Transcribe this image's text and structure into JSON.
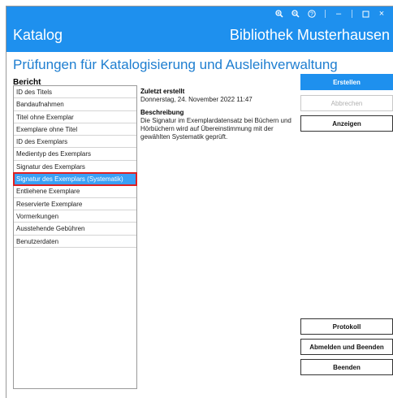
{
  "window": {
    "icons": [
      "zoom-in-icon",
      "zoom-out-icon",
      "help-icon",
      "minimize-icon",
      "maximize-icon",
      "close-icon"
    ],
    "glyphs": {
      "zoom_in": "🔍",
      "zoom_out": "🔍",
      "help": "?",
      "minimize": "–",
      "maximize": "☐",
      "close": "×"
    }
  },
  "header": {
    "app_title": "Katalog",
    "library_name": "Bibliothek Musterhausen"
  },
  "page": {
    "title": "Prüfungen für Katalogisierung und Ausleihverwaltung",
    "report_label": "Bericht"
  },
  "reports": {
    "items": [
      "ID des Titels",
      "Bandaufnahmen",
      "Titel ohne Exemplar",
      "Exemplare ohne Titel",
      "ID des Exemplars",
      "Medientyp des Exemplars",
      "Signatur des Exemplars",
      "Signatur des Exemplars (Systematik)",
      "Entliehene Exemplare",
      "Reservierte Exemplare",
      "Vormerkungen",
      "Ausstehende Gebühren",
      "Benutzerdaten"
    ],
    "selected_index": 7
  },
  "detail": {
    "last_created_label": "Zuletzt erstellt",
    "last_created_value": "Donnerstag, 24. November 2022 11:47",
    "description_label": "Beschreibung",
    "description_text": "Die Signatur im Exemplardatensatz bei Büchern und Hörbüchern wird auf Übereinstimmung mit der gewählten Systematik geprüft."
  },
  "buttons": {
    "create": "Erstellen",
    "cancel": "Abbrechen",
    "show": "Anzeigen",
    "log": "Protokoll",
    "logout_quit": "Abmelden und Beenden",
    "quit": "Beenden"
  },
  "colors": {
    "accent": "#1e90ee",
    "selection": "#3aa0f5",
    "highlight_border": "#e02020"
  }
}
